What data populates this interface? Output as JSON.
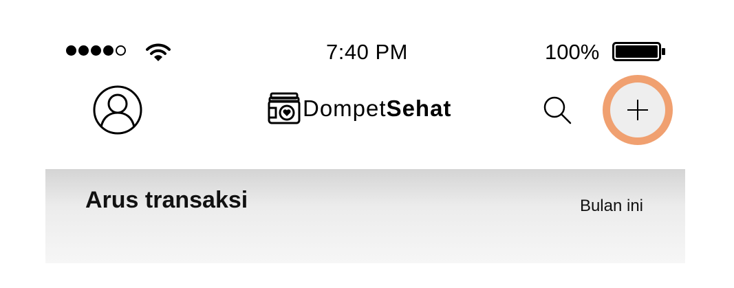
{
  "status_bar": {
    "signal_bars_filled": 4,
    "signal_bars_total": 5,
    "wifi_icon": "wifi-icon",
    "time": "7:40 PM",
    "battery_percent": "100%",
    "battery_icon": "battery-full-icon"
  },
  "nav": {
    "profile_icon": "user-profile-icon",
    "brand": {
      "logo_icon": "wallet-heart-icon",
      "name_light": "Dompet",
      "name_bold": "Sehat"
    },
    "search_icon": "search-icon",
    "add_icon": "plus-icon",
    "add_highlight_color": "#F0A070"
  },
  "section": {
    "title": "Arus transaksi",
    "filter": "Bulan ini"
  }
}
